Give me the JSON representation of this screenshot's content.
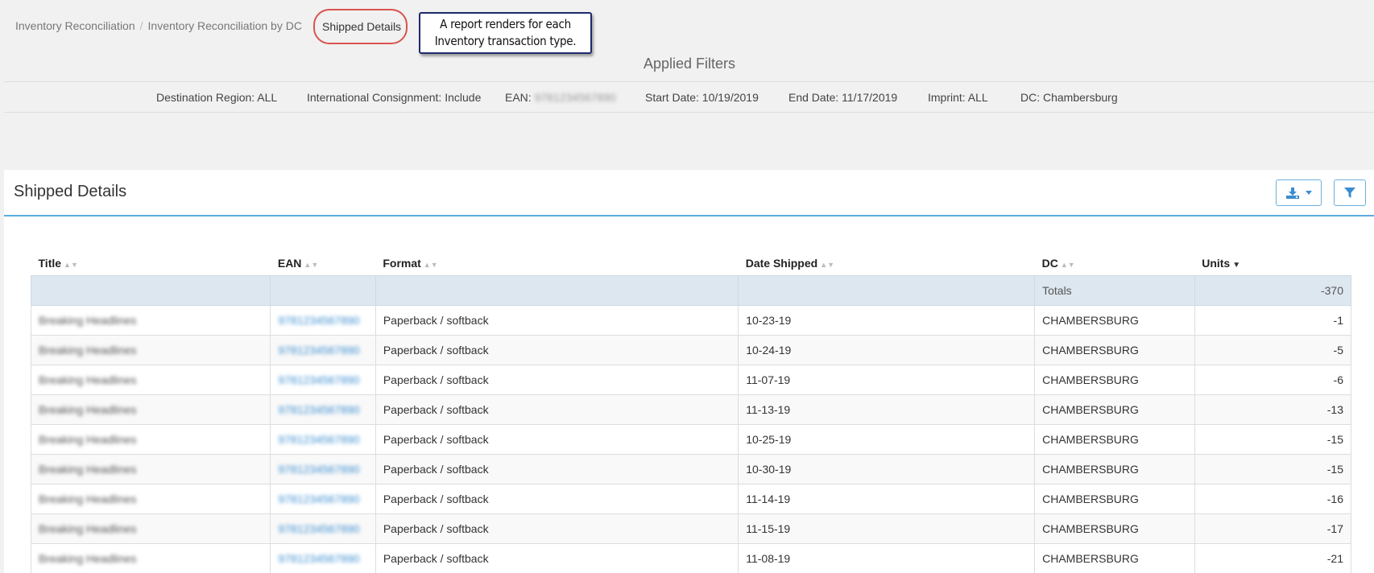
{
  "breadcrumb": {
    "items": [
      "Inventory Reconciliation",
      "Inventory Reconciliation by DC"
    ],
    "separator": "/",
    "current": "Shipped Details"
  },
  "callout": {
    "line1": "A report renders for each",
    "line2": "Inventory transaction type."
  },
  "applied_filters": {
    "title": "Applied Filters",
    "destination_region": "Destination Region: ALL",
    "international_consignment": "International Consignment: Include",
    "ean_label": "EAN:",
    "ean_value": "9781234567890",
    "start_date": "Start Date: 10/19/2019",
    "end_date": "End Date: 11/17/2019",
    "imprint": "Imprint: ALL",
    "dc": "DC: Chambersburg"
  },
  "panel": {
    "title": "Shipped Details",
    "download_icon": "download-icon",
    "filter_icon": "filter-icon"
  },
  "table": {
    "columns": [
      "Title",
      "EAN",
      "Format",
      "Date Shipped",
      "DC",
      "Units"
    ],
    "totals_label": "Totals",
    "totals_value": "-370",
    "rows": [
      {
        "title": "Breaking Headlines",
        "ean": "9781234567890",
        "format": "Paperback / softback",
        "date": "10-23-19",
        "dc": "CHAMBERSBURG",
        "units": "-1"
      },
      {
        "title": "Breaking Headlines",
        "ean": "9781234567890",
        "format": "Paperback / softback",
        "date": "10-24-19",
        "dc": "CHAMBERSBURG",
        "units": "-5"
      },
      {
        "title": "Breaking Headlines",
        "ean": "9781234567890",
        "format": "Paperback / softback",
        "date": "11-07-19",
        "dc": "CHAMBERSBURG",
        "units": "-6"
      },
      {
        "title": "Breaking Headlines",
        "ean": "9781234567890",
        "format": "Paperback / softback",
        "date": "11-13-19",
        "dc": "CHAMBERSBURG",
        "units": "-13"
      },
      {
        "title": "Breaking Headlines",
        "ean": "9781234567890",
        "format": "Paperback / softback",
        "date": "10-25-19",
        "dc": "CHAMBERSBURG",
        "units": "-15"
      },
      {
        "title": "Breaking Headlines",
        "ean": "9781234567890",
        "format": "Paperback / softback",
        "date": "10-30-19",
        "dc": "CHAMBERSBURG",
        "units": "-15"
      },
      {
        "title": "Breaking Headlines",
        "ean": "9781234567890",
        "format": "Paperback / softback",
        "date": "11-14-19",
        "dc": "CHAMBERSBURG",
        "units": "-16"
      },
      {
        "title": "Breaking Headlines",
        "ean": "9781234567890",
        "format": "Paperback / softback",
        "date": "11-15-19",
        "dc": "CHAMBERSBURG",
        "units": "-17"
      },
      {
        "title": "Breaking Headlines",
        "ean": "9781234567890",
        "format": "Paperback / softback",
        "date": "11-08-19",
        "dc": "CHAMBERSBURG",
        "units": "-21"
      }
    ]
  },
  "colors": {
    "accent": "#3a8dd0",
    "callout_border": "#1f2a6b",
    "highlight_circle": "#d9534f",
    "totals_bg": "#dde7f0"
  }
}
